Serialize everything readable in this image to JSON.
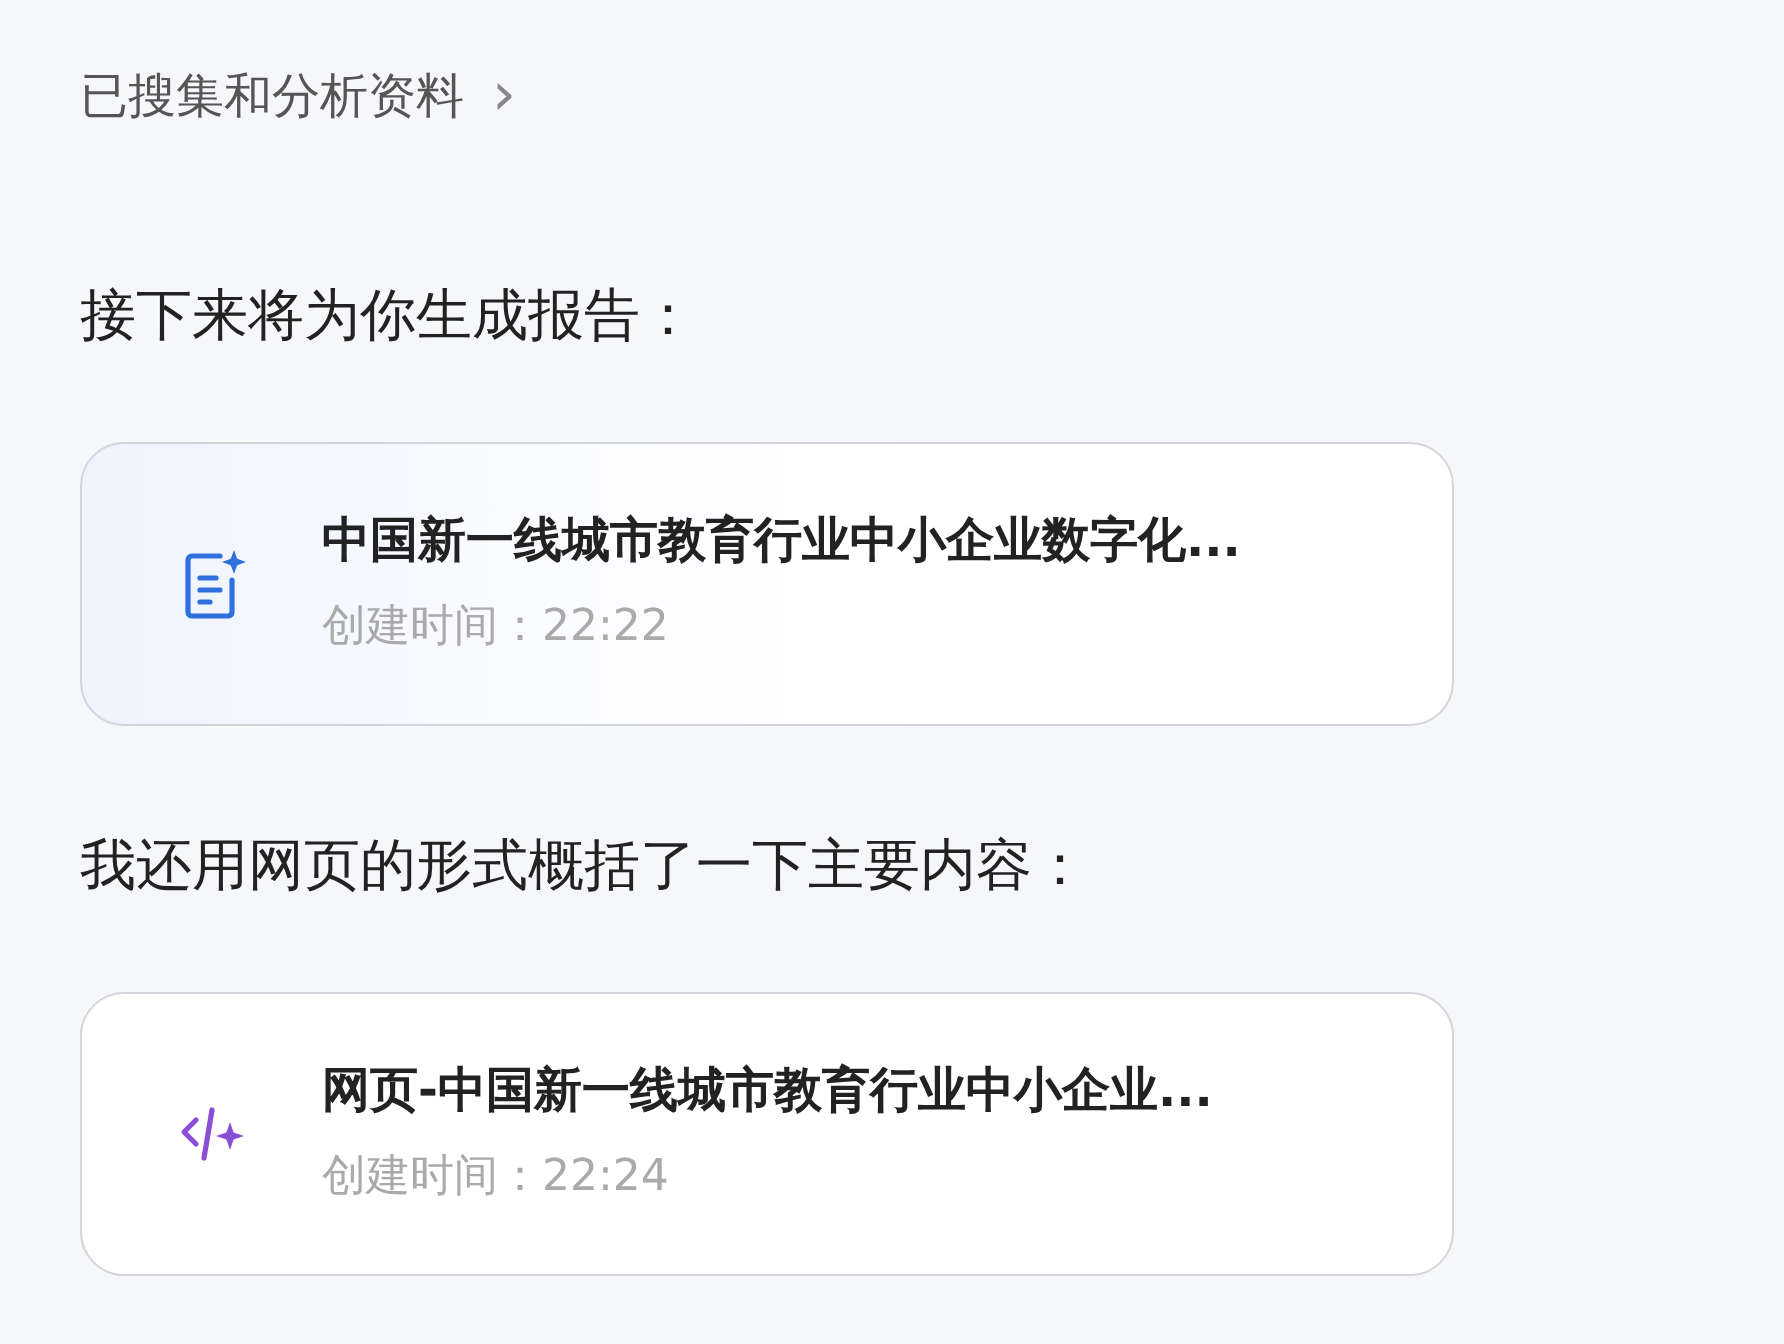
{
  "header": {
    "label": "已搜集和分析资料",
    "chevron": "›"
  },
  "sections": [
    {
      "intro": "接下来将为你生成报告：",
      "card": {
        "kind": "document",
        "title": "中国新一线城市教育行业中小企业数字化...",
        "created": "创建时间：22:22"
      }
    },
    {
      "intro": "我还用网页的形式概括了一下主要内容：",
      "card": {
        "kind": "webpage",
        "title": "网页-中国新一线城市教育行业中小企业...",
        "created": "创建时间：22:24"
      }
    }
  ]
}
